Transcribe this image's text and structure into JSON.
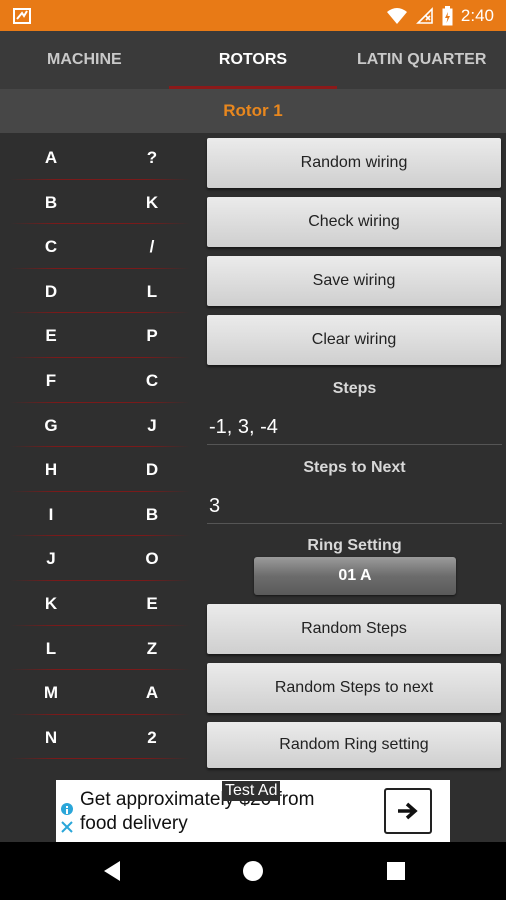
{
  "status_bar": {
    "time": "2:40",
    "icons": [
      "app-icon",
      "wifi-icon",
      "no-signal-icon",
      "battery-icon"
    ],
    "color": "#e87a16"
  },
  "tabs": [
    {
      "label": "MACHINE",
      "active": false
    },
    {
      "label": "ROTORS",
      "active": true
    },
    {
      "label": "LATIN QUARTER",
      "active": false
    }
  ],
  "rotor": {
    "title": "Rotor 1",
    "accent": "#e8871e"
  },
  "wiring": [
    {
      "input": "A",
      "output": "?"
    },
    {
      "input": "B",
      "output": "K"
    },
    {
      "input": "C",
      "output": "/"
    },
    {
      "input": "D",
      "output": "L"
    },
    {
      "input": "E",
      "output": "P"
    },
    {
      "input": "F",
      "output": "C"
    },
    {
      "input": "G",
      "output": "J"
    },
    {
      "input": "H",
      "output": "D"
    },
    {
      "input": "I",
      "output": "B"
    },
    {
      "input": "J",
      "output": "O"
    },
    {
      "input": "K",
      "output": "E"
    },
    {
      "input": "L",
      "output": "Z"
    },
    {
      "input": "M",
      "output": "A"
    },
    {
      "input": "N",
      "output": "2"
    }
  ],
  "panel": {
    "random_wiring": "Random wiring",
    "check_wiring": "Check wiring",
    "save_wiring": "Save wiring",
    "clear_wiring": "Clear wiring",
    "steps_label": "Steps",
    "steps_value": "-1, 3, -4",
    "steps_next_label": "Steps to Next",
    "steps_next_value": "3",
    "ring_label": "Ring Setting",
    "ring_value": "01 A",
    "random_steps": "Random Steps",
    "random_steps_next": "Random Steps to next",
    "random_ring": "Random Ring setting"
  },
  "ad": {
    "badge": "Test Ad",
    "line1": "Get approximately $20 from",
    "line2": "food delivery"
  },
  "nav": {
    "items": [
      "back-icon",
      "home-icon",
      "recents-icon"
    ]
  }
}
